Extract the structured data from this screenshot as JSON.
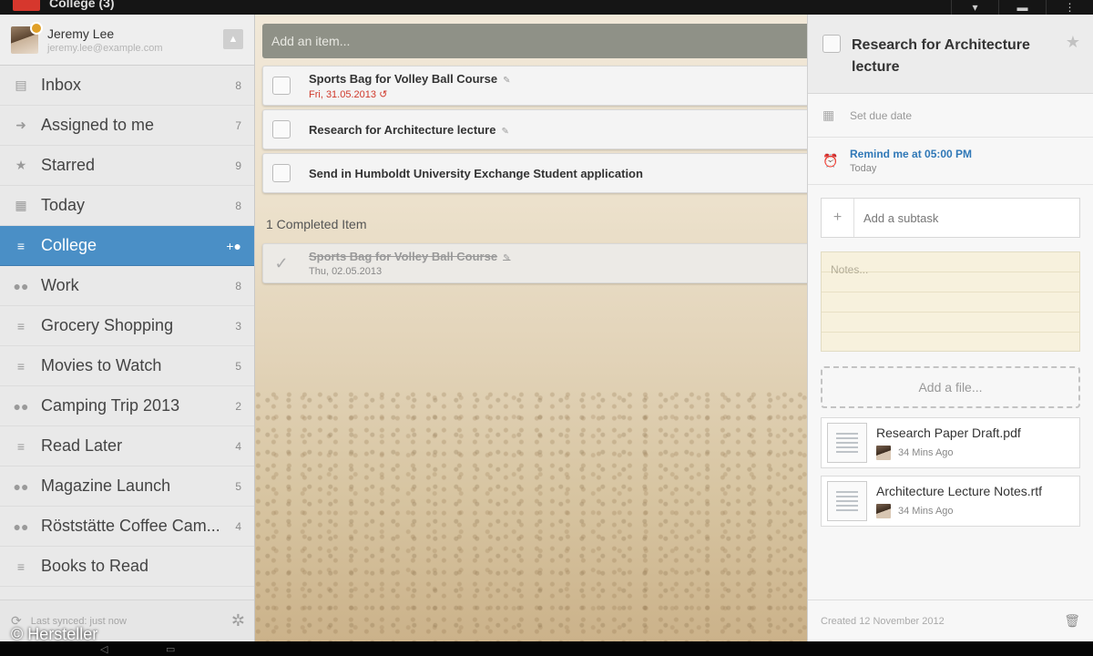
{
  "app": {
    "title": "College (3)"
  },
  "user": {
    "name": "Jeremy Lee",
    "email": "jeremy.lee@example.com"
  },
  "sidebar": {
    "items": [
      {
        "label": "Inbox",
        "count": "8",
        "icon": "inbox-icon"
      },
      {
        "label": "Assigned to me",
        "count": "7",
        "icon": "assigned-icon"
      },
      {
        "label": "Starred",
        "count": "9",
        "icon": "star-icon"
      },
      {
        "label": "Today",
        "count": "8",
        "icon": "calendar-icon"
      },
      {
        "label": "College",
        "count": "",
        "icon": "list-icon",
        "active": true
      },
      {
        "label": "Work",
        "count": "8",
        "icon": "shared-list-icon"
      },
      {
        "label": "Grocery Shopping",
        "count": "3",
        "icon": "list-icon"
      },
      {
        "label": "Movies to Watch",
        "count": "5",
        "icon": "list-icon"
      },
      {
        "label": "Camping Trip 2013",
        "count": "2",
        "icon": "shared-list-icon"
      },
      {
        "label": "Read Later",
        "count": "4",
        "icon": "list-icon"
      },
      {
        "label": "Magazine Launch",
        "count": "5",
        "icon": "shared-list-icon"
      },
      {
        "label": "Röststätte Coffee Cam...",
        "count": "4",
        "icon": "shared-list-icon"
      },
      {
        "label": "Books to Read",
        "count": "",
        "icon": "list-icon"
      }
    ],
    "sync_text": "Last synced: just now"
  },
  "main": {
    "add_placeholder": "Add an item...",
    "tasks": [
      {
        "title": "Sports Bag for Volley Ball Course",
        "date": "Fri, 31.05.2013"
      },
      {
        "title": "Research for Architecture lecture",
        "date": ""
      },
      {
        "title": "Send in Humboldt University Exchange Student application",
        "date": ""
      }
    ],
    "completed_label": "1 Completed Item",
    "completed": [
      {
        "title": "Sports Bag for Volley Ball Course",
        "date": "Thu, 02.05.2013"
      }
    ]
  },
  "detail": {
    "title": "Research for Architecture lecture",
    "due_date": "Set due date",
    "remind_title": "Remind me at 05:00 PM",
    "remind_sub": "Today",
    "subtask_placeholder": "Add a subtask",
    "notes_placeholder": "Notes...",
    "add_file": "Add a file...",
    "files": [
      {
        "name": "Research Paper Draft.pdf",
        "time": "34 Mins Ago"
      },
      {
        "name": "Architecture Lecture Notes.rtf",
        "time": "34 Mins Ago"
      }
    ],
    "created": "Created 12 November 2012"
  },
  "watermark": "© Hersteller",
  "colors": {
    "accent": "#4a8fc6",
    "due_date": "#d0392b",
    "reminder": "#2f78b7"
  }
}
